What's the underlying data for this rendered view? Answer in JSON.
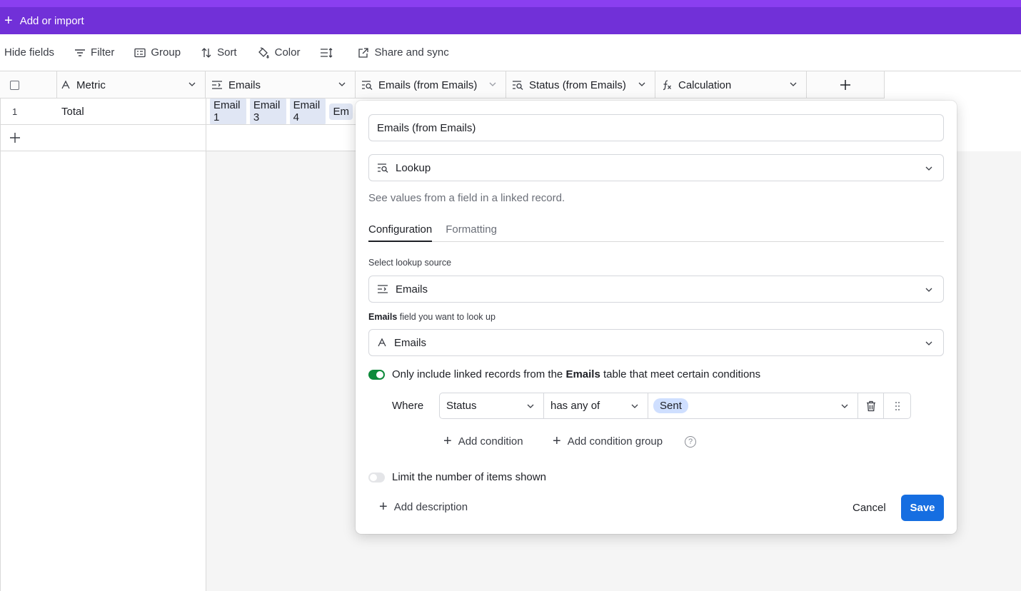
{
  "topbar": {
    "add_label": "Add or import"
  },
  "toolbar": {
    "hide_fields": "Hide fields",
    "filter": "Filter",
    "group": "Group",
    "sort": "Sort",
    "color": "Color",
    "share": "Share and sync"
  },
  "columns": [
    {
      "label": "Metric",
      "icon": "text-icon"
    },
    {
      "label": "Emails",
      "icon": "link-icon"
    },
    {
      "label": "Emails (from Emails)",
      "icon": "lookup-icon"
    },
    {
      "label": "Status (from Emails)",
      "icon": "lookup-icon"
    },
    {
      "label": "Calculation",
      "icon": "formula-icon"
    }
  ],
  "rows": [
    {
      "number": "1",
      "metric": "Total",
      "emails": [
        "Email 1",
        "Email 3",
        "Email 4",
        "Em"
      ]
    }
  ],
  "popup": {
    "field_name": "Emails (from Emails)",
    "field_type": "Lookup",
    "description": "See values from a field in a linked record.",
    "tabs": [
      "Configuration",
      "Formatting"
    ],
    "source_label": "Select lookup source",
    "source_value": "Emails",
    "lookup_label_bold": "Emails",
    "lookup_label_rest": " field you want to look up",
    "lookup_value": "Emails",
    "conditions_toggle_pre": "Only include linked records from the ",
    "conditions_toggle_bold": "Emails",
    "conditions_toggle_post": " table that meet certain conditions",
    "condition": {
      "where": "Where",
      "field": "Status",
      "operator": "has any of",
      "value": "Sent"
    },
    "add_condition": "Add condition",
    "add_condition_group": "Add condition group",
    "help": "?",
    "limit_label": "Limit the number of items shown",
    "add_description": "Add description",
    "cancel": "Cancel",
    "save": "Save"
  },
  "colors": {
    "topbar": "#7130d8",
    "toggle_on": "#0d8a3a",
    "save_button": "#166ee1",
    "sent_pill": "#cfdfff"
  }
}
